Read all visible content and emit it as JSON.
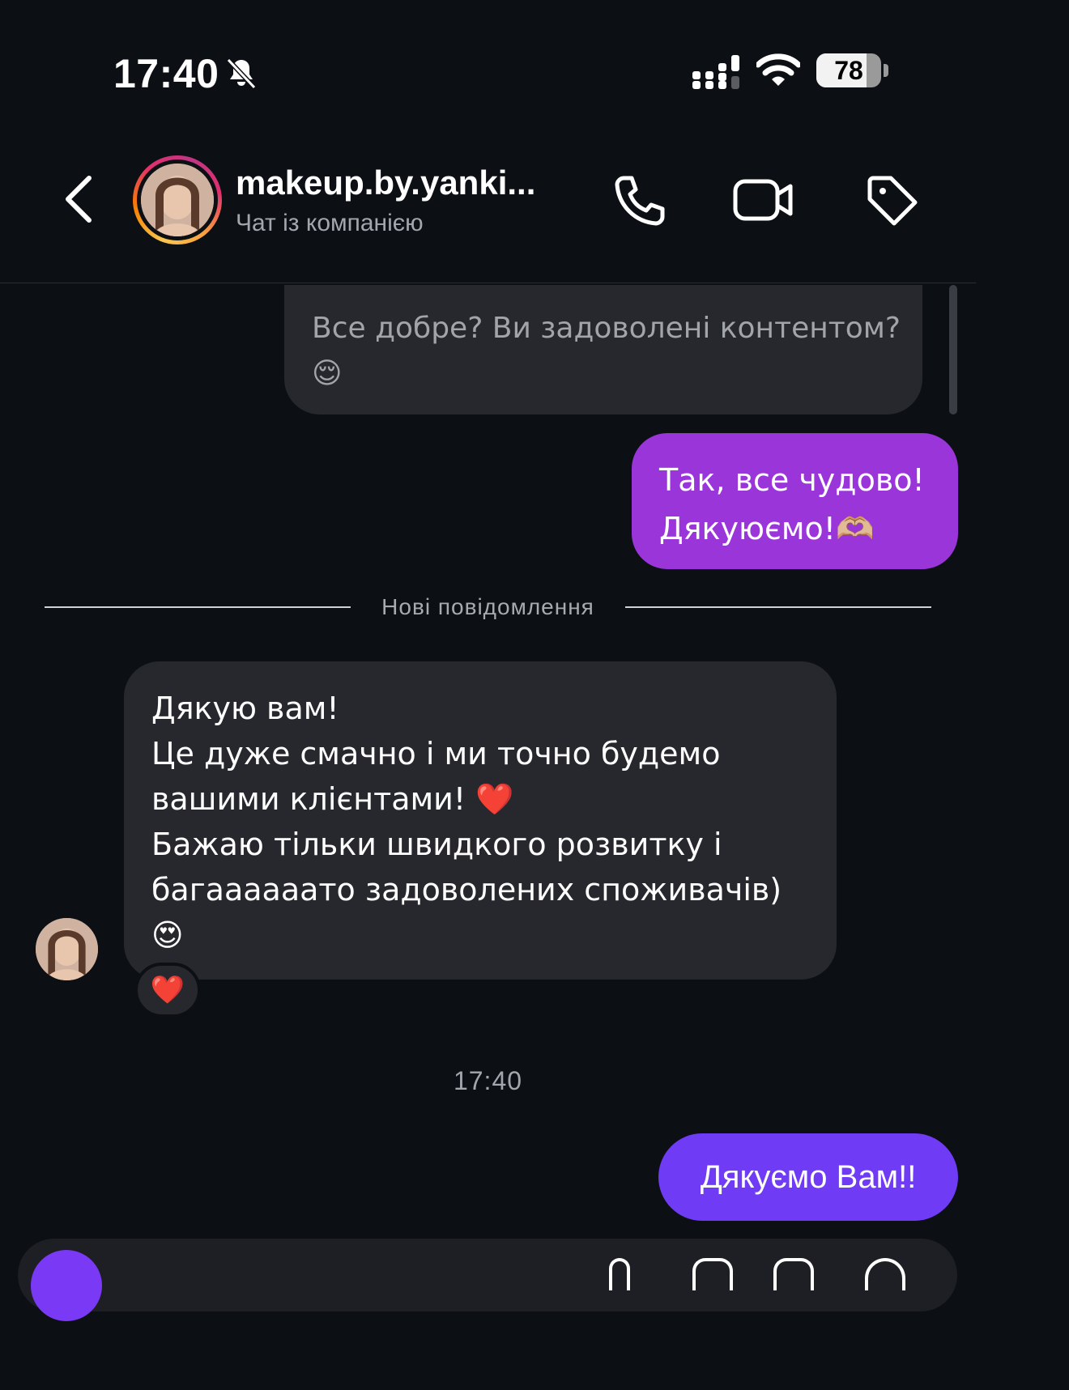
{
  "status_bar": {
    "time": "17:40",
    "battery": "78",
    "battery_level": 0.78,
    "icons": [
      "bell-slash-icon",
      "cellular-signal-icon",
      "wifi-icon",
      "battery-icon"
    ]
  },
  "header": {
    "name": "makeup.by.yanki...",
    "subtitle": "Чат із компанією",
    "actions": [
      "phone-icon",
      "video-camera-icon",
      "tag-icon"
    ]
  },
  "messages": [
    {
      "side": "incoming",
      "text": "Все добре? Ви задоволені контентом?\n😌"
    },
    {
      "side": "outgoing",
      "text": "Так, все чудово!\nДякуюємо!🫶🏼"
    },
    {
      "side": "incoming",
      "text": "Дякую вам!\nЦе дуже смачно і ми точно будемо\nвашими клієнтами! ❤️\nБажаю тільки швидкого розвитку і\nбагаааааато задоволених споживачів)\n😍",
      "reaction": "❤️"
    },
    {
      "side": "outgoing",
      "text": "Дякуємо Вам!!"
    }
  ],
  "divider": {
    "label": "Нові повідомлення"
  },
  "timestamp": "17:40",
  "colors": {
    "background": "#0c0f14",
    "incoming_bubble": "#26282d",
    "outgoing_bubble_1": "#9a35d9",
    "outgoing_bubble_2": "#6f3bf5",
    "secondary_text": "#a3a7ad"
  }
}
